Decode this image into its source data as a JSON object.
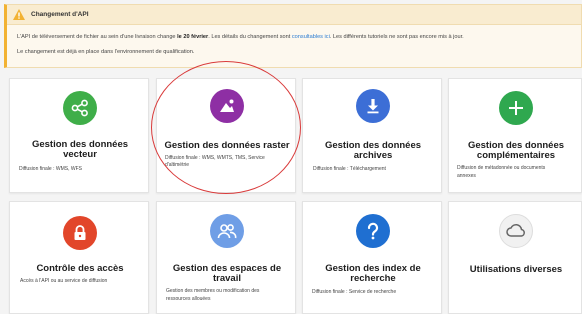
{
  "alert": {
    "title": "Changement d'API",
    "line1_pre": "L'API de téléversement de fichier au sein d'une livraison change ",
    "line1_bold": "le 20 février",
    "line1_mid": ". Les détails du changement sont ",
    "line1_link": "consultables ici",
    "line1_post": ". Les différents tutoriels ne sont pas encore mis à jour.",
    "line2": "Le changement est déjà en place dans l'environnement de qualification.",
    "icon": "warning-icon",
    "color": "#f2b233"
  },
  "cards": [
    {
      "title1": "Gestion des données",
      "title2": "vecteur",
      "desc1": "Diffusion finale : WMS, WFS",
      "desc2": "",
      "icon": "share-icon",
      "color": "#3fae49"
    },
    {
      "title1": "Gestion des données raster",
      "title2": "",
      "desc1": "Diffusion finale : WMS, WMTS, TMS, Service",
      "desc2": "d'altimétrie",
      "icon": "image-icon",
      "color": "#8e2fa4"
    },
    {
      "title1": "Gestion des données",
      "title2": "archives",
      "desc1": "Diffusion finale : Téléchargement",
      "desc2": "",
      "icon": "download-icon",
      "color": "#3c6ed6"
    },
    {
      "title1": "Gestion des données",
      "title2": "complémentaires",
      "desc1": "Diffusion de métadonnée ou documents",
      "desc2": "annexes",
      "icon": "plus-icon",
      "color": "#2fa84f"
    },
    {
      "title1": "Contrôle des accès",
      "title2": "",
      "desc1": "Accès à l'API ou au service de diffusion",
      "desc2": "",
      "icon": "lock-icon",
      "color": "#e2462a"
    },
    {
      "title1": "Gestion des espaces de",
      "title2": "travail",
      "desc1": "Gestion des membres ou modification des",
      "desc2": "ressources allouées",
      "icon": "users-icon",
      "color": "#6f9ee6"
    },
    {
      "title1": "Gestion des index de",
      "title2": "recherche",
      "desc1": "Diffusion finale : Service de recherche",
      "desc2": "",
      "icon": "question-icon",
      "color": "#1f6fd1"
    },
    {
      "title1": "Utilisations diverses",
      "title2": "",
      "desc1": "",
      "desc2": "",
      "icon": "cloud-icon",
      "color": "#f1f1f1"
    }
  ]
}
